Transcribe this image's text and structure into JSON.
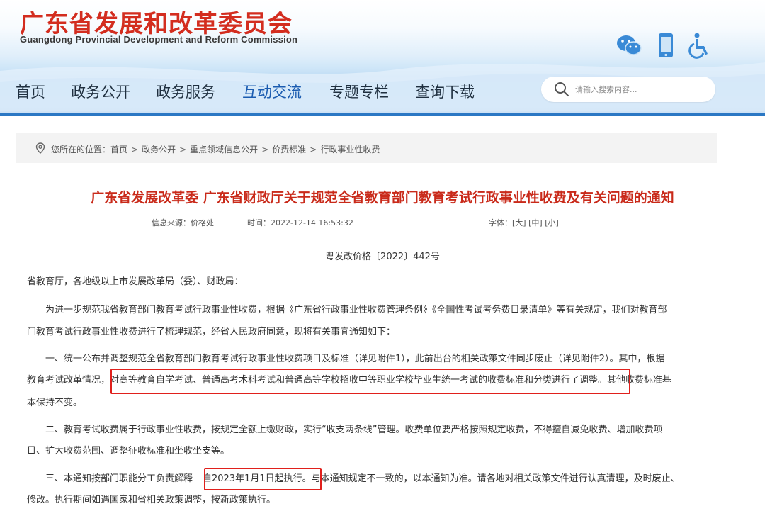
{
  "header": {
    "logo_cn": "广东省发展和改革委员会",
    "logo_en": "Guangdong Provincial Development and Reform Commission",
    "icons": [
      "wechat-icon",
      "mobile-icon",
      "accessibility-icon"
    ],
    "colors": {
      "logo_red": "#d32d1f",
      "nav_active": "#1a5bb0",
      "band_blue": "#2b78c4"
    }
  },
  "nav": {
    "items": [
      "首页",
      "政务公开",
      "政务服务",
      "互动交流",
      "专题专栏",
      "查询下载"
    ],
    "active": "互动交流"
  },
  "search": {
    "placeholder": "请输入搜索内容..."
  },
  "breadcrumb": {
    "prefix": "您所在的位置：",
    "items": [
      "首页",
      "政务公开",
      "重点领域信息公开",
      "价费标准",
      "行政事业性收费"
    ],
    "separator": ">"
  },
  "article": {
    "title": "广东省发展改革委 广东省财政厅关于规范全省教育部门教育考试行政事业性收费及有关问题的通知",
    "source": "信息来源：价格处",
    "time": "时间：2022-12-14 16:53:32",
    "font_label": "字体：",
    "font_sizes": [
      "[大]",
      "[中]",
      "[小]"
    ],
    "doc_number": "粤发改价格〔2022〕442号",
    "salutation": "省教育厅，各地级以上市发展改革局（委）、财政局：",
    "p1": {
      "l1": "为进一步规范我省教育部门教育考试行政事业性收费，根据《广东省行政事业性收费管理条例》《全国性考试考务费目录清单》等有关规定，我们对教育部",
      "l2": "门教育考试行政事业性收费进行了梳理规范，经省人民政府同意，现将有关事宜通知如下："
    },
    "p2": {
      "l1": "一、统一公布并调整规范全省教育部门教育考试行政事业性收费项目及标准（详见附件1），此前出台的相关政策文件同步废止（详见附件2）。其中，根据",
      "l2a": "教育考试改革情况，",
      "l2b": "对高等教育自学考试、普通高考术科考试和普通高等学校招收中等职业学校毕业生统一考试的收费标准和分类进行了调整",
      "l2c": "。其他收费标准基",
      "l3": "本保持不变。"
    },
    "p3": {
      "l1": "二、教育考试收费属于行政事业性收费，按规定全额上缴财政，实行“收支两条线”管理。收费单位要严格按照规定收费，不得擅自减免收费、增加收费项",
      "l2": "目、扩大收费范围、调整征收标准和坐收坐支等。"
    },
    "p4": {
      "l1a": "三、本通知按部门职能分工负责解释",
      "l1b": "自2023年1月1日起执行。",
      "l1c": "与本通知规定不一致的，以本通知为准。请各地对相关政策文件进行认真清理，及时废止、",
      "l2": "修改。执行期间如遇国家和省相关政策调整，按新政策执行。"
    },
    "highlight_color": "#e0201c"
  }
}
